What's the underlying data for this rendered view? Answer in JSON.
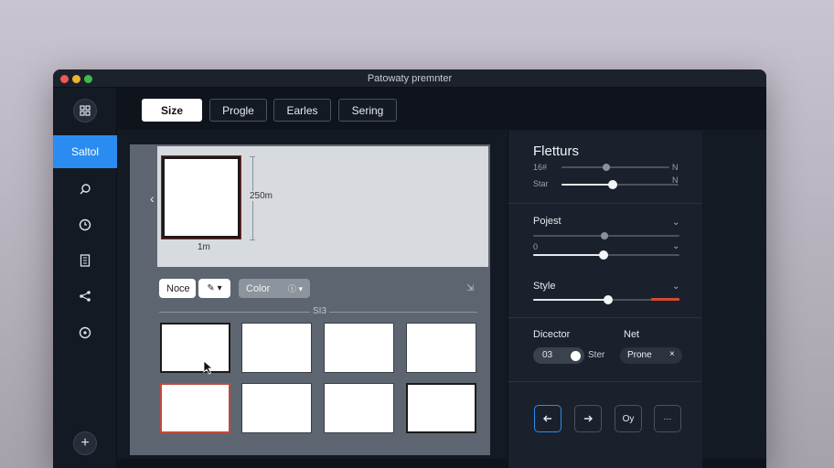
{
  "window": {
    "title": "Patowaty premnter"
  },
  "rail": {
    "active_label": "Saltol",
    "icons": [
      "grid-icon",
      "search-icon",
      "clock-icon",
      "file-icon",
      "share-icon",
      "help-icon",
      "plus-icon"
    ]
  },
  "tabs": [
    {
      "label": "Size",
      "active": true
    },
    {
      "label": "Progle",
      "active": false
    },
    {
      "label": "Earles",
      "active": false
    },
    {
      "label": "Sering",
      "active": false
    }
  ],
  "canvas": {
    "dim_vertical": "250m",
    "dim_horizontal": "1m",
    "chip_none": "Noce",
    "chip_color": "Color",
    "separator_label": "SI3"
  },
  "panel": {
    "title": "Fletturs",
    "row1_left": "16#",
    "row1_right": "N",
    "row2_left": "Star",
    "row2_right": "N",
    "project_label": "Pojest",
    "project_small": "0",
    "style_label": "Style",
    "director_label": "Dicector",
    "net_label": "Net",
    "toggle_label": "03",
    "toggle_right": "Ster",
    "net_value": "Prone",
    "net_close": "×",
    "nav_ok": "Oy",
    "nav_more": "···"
  },
  "colors": {
    "accent": "#2a8cf0",
    "slider_red": "#d64a2e"
  }
}
